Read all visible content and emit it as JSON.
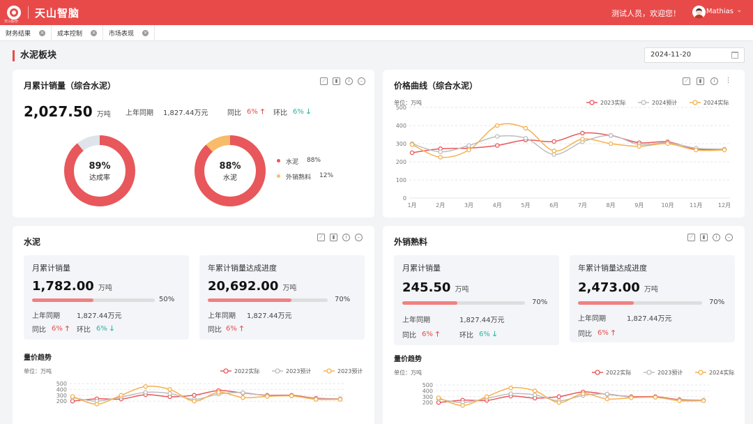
{
  "app": {
    "logo_text": "天山股份",
    "brand": "天山智脑",
    "welcome": "测试人员，欢迎您！",
    "user": "Mathias"
  },
  "tabs": [
    {
      "label": "财务结果"
    },
    {
      "label": "成本控制"
    },
    {
      "label": "市场表现"
    }
  ],
  "page": {
    "section_title": "水泥板块",
    "date": "2024-11-20"
  },
  "colors": {
    "brand": "#e84a4a",
    "series_2023": "#e8575b",
    "series_2024_plan": "#bdbdbd",
    "series_2024_actual": "#f5b04c",
    "up": "#e84a4a",
    "down": "#2bb3a0"
  },
  "sales_card": {
    "title": "月累计销量（综合水泥）",
    "value": "2,027.50",
    "unit": "万吨",
    "last_year_label": "上年同期",
    "last_year_value": "1,827.44万元",
    "yoy_label": "同比",
    "yoy_value": "6%",
    "mom_label": "环比",
    "mom_value": "6%",
    "donut1": {
      "percent": 89,
      "label": "89%",
      "caption": "达成率"
    },
    "donut2": {
      "percent": 88,
      "label": "88%",
      "caption": "水泥"
    },
    "legend": [
      {
        "name": "水泥",
        "value": "88%",
        "color": "#e8575b"
      },
      {
        "name": "外销熟料",
        "value": "12%",
        "color": "#f5c06a"
      }
    ]
  },
  "price_card": {
    "title": "价格曲线（综合水泥）",
    "unit_label": "单位：万吨",
    "chart_data": {
      "type": "line",
      "categories": [
        "1月",
        "2月",
        "3月",
        "4月",
        "5月",
        "6月",
        "7月",
        "8月",
        "9月",
        "10月",
        "11月",
        "12月"
      ],
      "ylim": [
        0,
        500
      ],
      "yticks": [
        "0",
        "100",
        "200",
        "300",
        "400",
        "500"
      ],
      "legend_position": "top-right",
      "series": [
        {
          "name": "2023实际",
          "color": "#e8575b",
          "values": [
            250,
            272,
            275,
            290,
            320,
            312,
            358,
            345,
            305,
            310,
            270,
            268
          ]
        },
        {
          "name": "2024预计",
          "color": "#bdbdbd",
          "values": [
            300,
            255,
            290,
            340,
            330,
            240,
            310,
            345,
            295,
            305,
            275,
            270
          ]
        },
        {
          "name": "2024实际",
          "color": "#f5b04c",
          "values": [
            295,
            225,
            265,
            400,
            385,
            260,
            325,
            300,
            285,
            300,
            265,
            265
          ]
        }
      ]
    }
  },
  "cement_card": {
    "title": "水泥",
    "monthly": {
      "title": "月累计销量",
      "value": "1,782.00",
      "unit": "万吨",
      "progress": 50,
      "progress_label": "50%",
      "last_year_label": "上年同期",
      "last_year_value": "1,827.44万元",
      "yoy_label": "同比",
      "yoy_value": "6%",
      "mom_label": "环比",
      "mom_value": "6%"
    },
    "yearly": {
      "title": "年累计销量达成进度",
      "value": "20,692.00",
      "unit": "万吨",
      "progress": 70,
      "progress_label": "70%",
      "last_year_label": "上年同期",
      "last_year_value": "1,827.44万元",
      "yoy_label": "同比",
      "yoy_value": "6%"
    },
    "trend": {
      "title": "量价趋势",
      "unit_label": "单位：万吨",
      "chart_data": {
        "type": "line",
        "ylim": [
          0,
          500
        ],
        "yticks": [
          "200",
          "300",
          "400",
          "500"
        ],
        "legend_position": "top-right",
        "series": [
          {
            "name": "2022实际",
            "color": "#e8575b",
            "values": [
              200,
              240,
              235,
              310,
              275,
              300,
              380,
              340,
              300,
              300,
              250,
              240
            ]
          },
          {
            "name": "2023预计",
            "color": "#bdbdbd",
            "values": [
              260,
              200,
              270,
              350,
              330,
              230,
              320,
              345,
              290,
              290,
              240,
              240
            ]
          },
          {
            "name": "2023预计",
            "color": "#f5b04c",
            "values": [
              280,
              150,
              300,
              450,
              400,
              200,
              350,
              260,
              280,
              290,
              230,
              230
            ]
          }
        ]
      }
    }
  },
  "clinker_card": {
    "title": "外销熟料",
    "monthly": {
      "title": "月累计销量",
      "value": "245.50",
      "unit": "万吨",
      "progress": 45,
      "progress_label": "70%",
      "last_year_label": "上年同期",
      "last_year_value": "1,827.44万元",
      "yoy_label": "同比",
      "yoy_value": "6%",
      "mom_label": "环比",
      "mom_value": "6%"
    },
    "yearly": {
      "title": "年累计销量达成进度",
      "value": "2,473.00",
      "unit": "万吨",
      "progress": 45,
      "progress_label": "70%",
      "last_year_label": "上年同期",
      "last_year_value": "1,827.44万元",
      "yoy_label": "同比",
      "yoy_value": "6%"
    },
    "trend": {
      "title": "量价趋势",
      "unit_label": "单位：万吨",
      "chart_data": {
        "type": "line",
        "ylim": [
          0,
          500
        ],
        "yticks": [
          "200",
          "300",
          "400",
          "500"
        ],
        "legend_position": "top-right",
        "series": [
          {
            "name": "2022实际",
            "color": "#e8575b",
            "values": [
              200,
              240,
              235,
              310,
              275,
              300,
              380,
              340,
              300,
              300,
              250,
              240
            ]
          },
          {
            "name": "2023预计",
            "color": "#bdbdbd",
            "values": [
              260,
              200,
              270,
              350,
              330,
              230,
              320,
              345,
              290,
              290,
              240,
              240
            ]
          },
          {
            "name": "2024实际",
            "color": "#f5b04c",
            "values": [
              280,
              150,
              300,
              450,
              400,
              200,
              350,
              260,
              280,
              290,
              230,
              230
            ]
          }
        ]
      }
    }
  }
}
